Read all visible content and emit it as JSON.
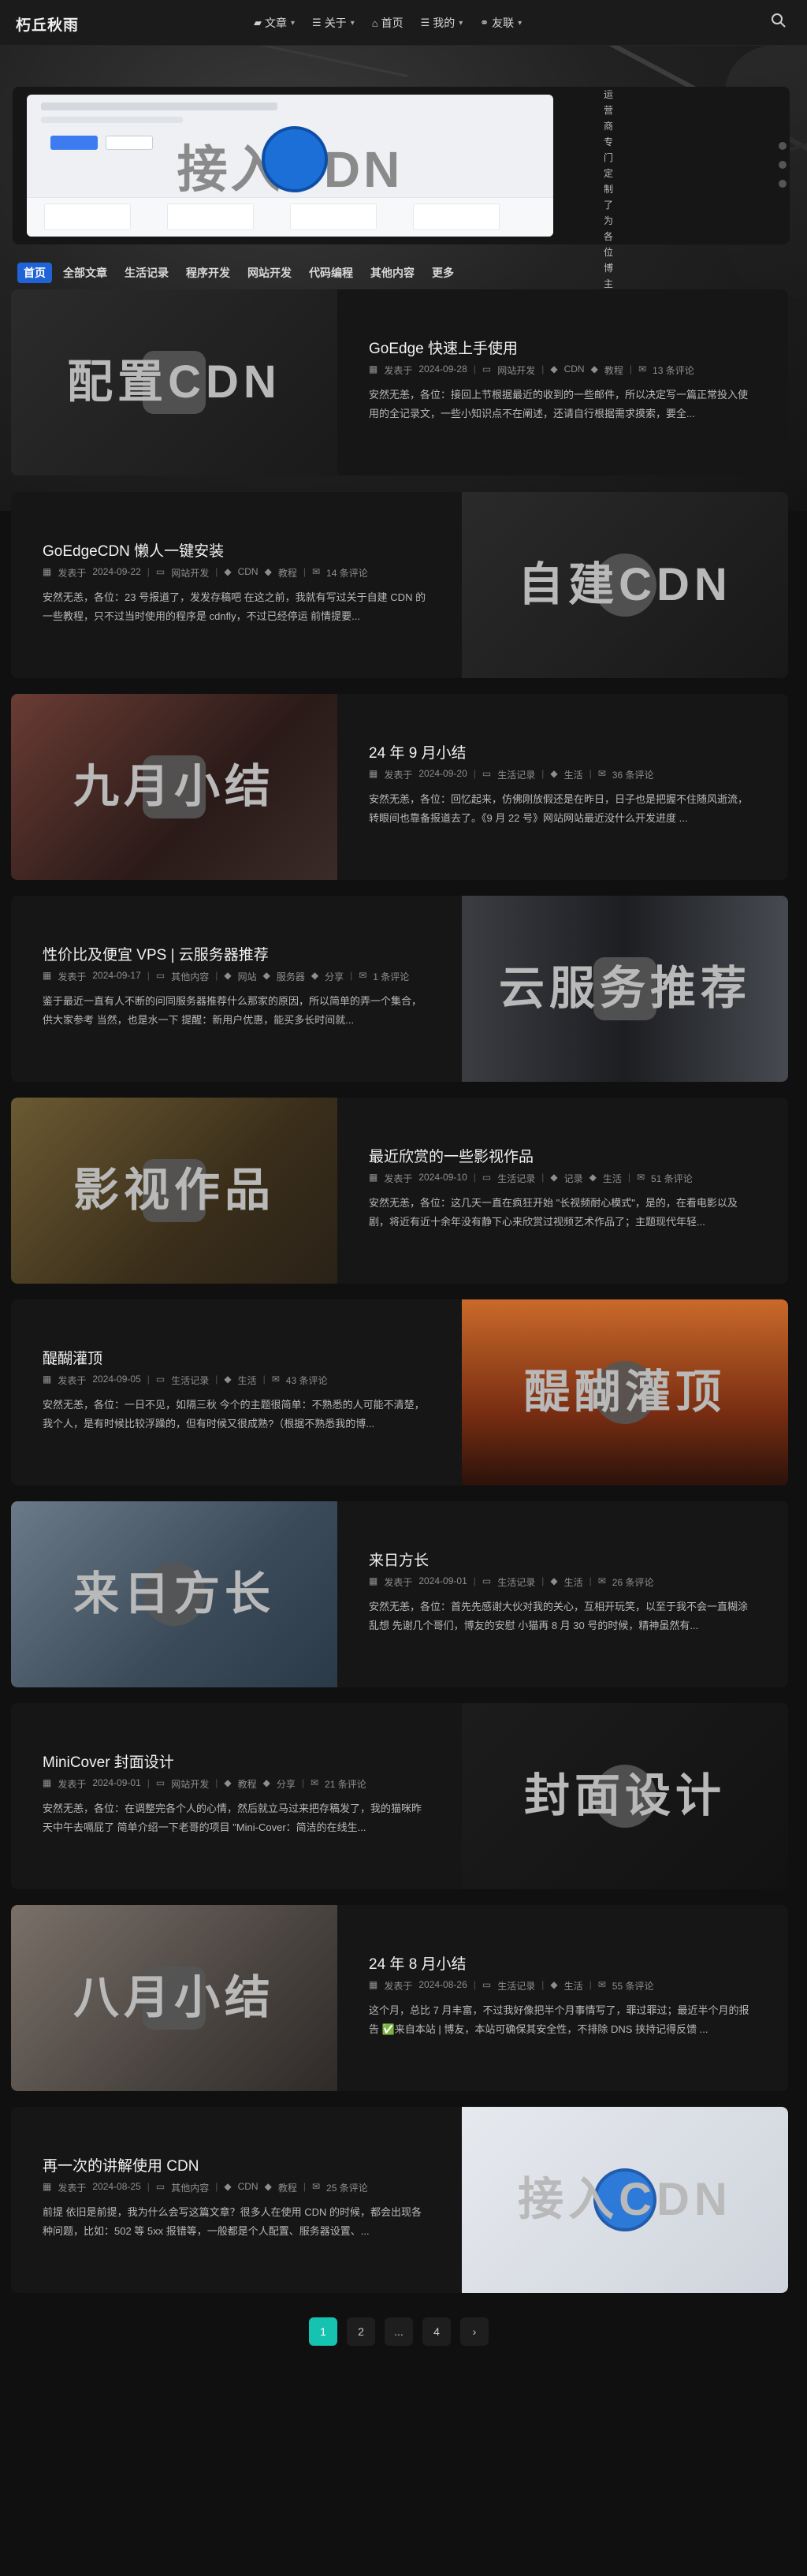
{
  "site": {
    "logo": "朽丘秋雨"
  },
  "nav": [
    {
      "label": "文章",
      "icon": "folder-icon",
      "dropdown": true
    },
    {
      "label": "关于",
      "icon": "list-icon",
      "dropdown": true
    },
    {
      "label": "首页",
      "icon": "home-icon",
      "dropdown": false
    },
    {
      "label": "我的",
      "icon": "list-icon",
      "dropdown": true
    },
    {
      "label": "友联",
      "icon": "link-icon",
      "dropdown": true
    }
  ],
  "banner": {
    "cover_text": "接入CDN",
    "description": "运营商专门定制了为各位博主们免费提供"
  },
  "tabs": [
    {
      "label": "首页",
      "active": true
    },
    {
      "label": "全部文章",
      "active": false
    },
    {
      "label": "生活记录",
      "active": false
    },
    {
      "label": "程序开发",
      "active": false
    },
    {
      "label": "网站开发",
      "active": false
    },
    {
      "label": "代码编程",
      "active": false
    },
    {
      "label": "其他内容",
      "active": false
    },
    {
      "label": "更多",
      "active": false
    }
  ],
  "posts": [
    {
      "title": "GoEdge 快速上手使用",
      "cover_text": "配置CDN",
      "date": "2024-09-28",
      "category": "网站开发",
      "tags": [
        "CDN",
        "教程"
      ],
      "comments": "13 条评论",
      "excerpt": "安然无恙，各位：接回上节根据最近的收到的一些邮件，所以决定写一篇正常投入使用的全记录文，一些小知识点不在阐述，还请自行根据需求摸索，要全..."
    },
    {
      "title": "GoEdgeCDN 懒人一键安装",
      "cover_text": "自建CDN",
      "date": "2024-09-22",
      "category": "网站开发",
      "tags": [
        "CDN",
        "教程"
      ],
      "comments": "14 条评论",
      "excerpt": "安然无恙，各位：23 号报道了，发发存稿吧 在这之前，我就有写过关于自建 CDN 的一些教程，只不过当时使用的程序是 cdnfly，不过已经停运 前情提要..."
    },
    {
      "title": "24 年 9 月小结",
      "cover_text": "九月小结",
      "date": "2024-09-20",
      "category": "生活记录",
      "tags": [
        "生活"
      ],
      "comments": "36 条评论",
      "excerpt": "安然无恙，各位：回忆起来，仿佛刚放假还是在昨日，日子也是把握不住随风逝流，转眼间也靠备报道去了。《9 月 22 号》网站网站最近没什么开发进度 ..."
    },
    {
      "title": "性价比及便宜 VPS | 云服务器推荐",
      "cover_text": "云服务推荐",
      "date": "2024-09-17",
      "category": "其他内容",
      "tags": [
        "网站",
        "服务器",
        "分享"
      ],
      "comments": "1 条评论",
      "excerpt": "鉴于最近一直有人不断的问同服务器推荐什么那家的原因，所以简单的弄一个集合，供大家参考 当然，也是水一下 提醒：新用户优惠，能买多长时间就..."
    },
    {
      "title": "最近欣赏的一些影视作品",
      "cover_text": "影视作品",
      "date": "2024-09-10",
      "category": "生活记录",
      "tags": [
        "记录",
        "生活"
      ],
      "comments": "51 条评论",
      "excerpt": "安然无恙，各位：这几天一直在疯狂开始 \"长视频耐心模式\"，是的，在看电影以及剧，将近有近十余年没有静下心来欣赏过视频艺术作品了；主题现代年轻..."
    },
    {
      "title": "醍醐灌顶",
      "cover_text": "醍醐灌顶",
      "date": "2024-09-05",
      "category": "生活记录",
      "tags": [
        "生活"
      ],
      "comments": "43 条评论",
      "excerpt": "安然无恙，各位：一日不见，如隔三秋 今个的主题很简单：不熟悉的人可能不清楚，我个人，是有时候比较浮躁的，但有时候又很成熟?（根据不熟悉我的博..."
    },
    {
      "title": "来日方长",
      "cover_text": "来日方长",
      "date": "2024-09-01",
      "category": "生活记录",
      "tags": [
        "生活"
      ],
      "comments": "26 条评论",
      "excerpt": "安然无恙，各位：首先先感谢大伙对我的关心，互相开玩笑，以至于我不会一直糊涂乱想 先谢几个哥们，博友的安慰 小猫再 8 月 30 号的时候，精神虽然有..."
    },
    {
      "title": "MiniCover 封面设计",
      "cover_text": "封面设计",
      "date": "2024-09-01",
      "category": "网站开发",
      "tags": [
        "教程",
        "分享"
      ],
      "comments": "21 条评论",
      "excerpt": "安然无恙，各位：在调整完各个人的心情，然后就立马过来把存稿发了，我的猫咪昨天中午去嗝屁了 简单介绍一下老哥的项目 \"Mini-Cover：简洁的在线生..."
    },
    {
      "title": "24 年 8 月小结",
      "cover_text": "八月小结",
      "date": "2024-08-26",
      "category": "生活记录",
      "tags": [
        "生活"
      ],
      "comments": "55 条评论",
      "excerpt": "这个月，总比 7 月丰富，不过我好像把半个月事情写了，罪过罪过；最近半个月的报告 ✅来自本站 | 博友，本站可确保其安全性，不排除 DNS 挟持记得反馈 ..."
    },
    {
      "title": "再一次的讲解使用 CDN",
      "cover_text": "接入CDN",
      "date": "2024-08-25",
      "category": "其他内容",
      "tags": [
        "CDN",
        "教程"
      ],
      "comments": "25 条评论",
      "excerpt": "前提 依旧是前提，我为什么会写这篇文章？很多人在使用 CDN 的时候，都会出现各种问题，比如：502 等 5xx 报错等，一般都是个人配置、服务器设置、..."
    }
  ],
  "meta_prefix": "发表于",
  "pagination": [
    "1",
    "2",
    "...",
    "4",
    "›"
  ],
  "colors": {
    "accent": "#1f63d6",
    "page_active": "#16c2b0",
    "bg": "#101010",
    "card": "#161616"
  }
}
